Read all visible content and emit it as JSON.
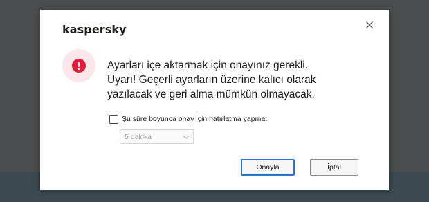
{
  "brand": {
    "logo_text": "kaspersky"
  },
  "dialog": {
    "message_lines": [
      "Ayarları içe aktarmak için onayınız gerekli.",
      "Uyarı! Geçerli ayarların üzerine kalıcı olarak",
      "yazılacak ve geri alma mümkün olmayacak."
    ],
    "reminder_checkbox": {
      "label": "Şu süre boyunca onay için hatırlatma yapma:",
      "checked": false
    },
    "duration_select": {
      "value": "5 dakika",
      "enabled": false
    },
    "buttons": {
      "confirm_label": "Onayla",
      "cancel_label": "İptal"
    }
  },
  "icons": {
    "close": "close-icon",
    "error": "error-icon",
    "dropdown": "chevron-down-icon"
  },
  "colors": {
    "error_red": "#e31937",
    "error_badge_bg": "#fbe7e9",
    "focus_blue": "#2a75c9",
    "backdrop": "#4b4d4e"
  }
}
